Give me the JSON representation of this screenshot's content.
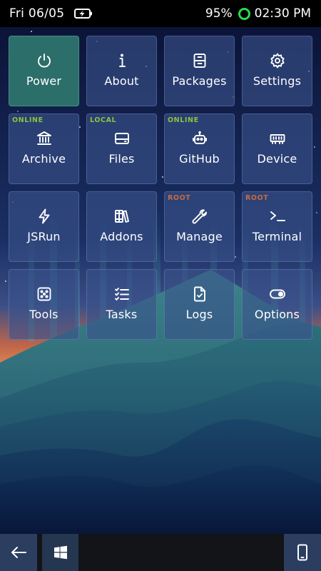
{
  "status_bar": {
    "date": "Fri 06/05",
    "battery_percent": "95%",
    "time": "02:30 PM",
    "charging_icon": "battery-charging-icon",
    "status_ring_color": "#2bd94b"
  },
  "tiles": [
    {
      "label": "Power",
      "icon": "power-icon",
      "tag": "",
      "active": true
    },
    {
      "label": "About",
      "icon": "info-icon",
      "tag": ""
    },
    {
      "label": "Packages",
      "icon": "package-icon",
      "tag": ""
    },
    {
      "label": "Settings",
      "icon": "gear-icon",
      "tag": ""
    },
    {
      "label": "Archive",
      "icon": "bank-icon",
      "tag": "ONLINE"
    },
    {
      "label": "Files",
      "icon": "hard-drive-icon",
      "tag": "LOCAL"
    },
    {
      "label": "GitHub",
      "icon": "robot-icon",
      "tag": "ONLINE"
    },
    {
      "label": "Device",
      "icon": "memory-chip-icon",
      "tag": ""
    },
    {
      "label": "JSRun",
      "icon": "lightning-icon",
      "tag": ""
    },
    {
      "label": "Addons",
      "icon": "books-icon",
      "tag": ""
    },
    {
      "label": "Manage",
      "icon": "wrench-icon",
      "tag": "ROOT"
    },
    {
      "label": "Terminal",
      "icon": "terminal-icon",
      "tag": "ROOT"
    },
    {
      "label": "Tools",
      "icon": "dice-icon",
      "tag": ""
    },
    {
      "label": "Tasks",
      "icon": "checklist-icon",
      "tag": ""
    },
    {
      "label": "Logs",
      "icon": "file-check-icon",
      "tag": ""
    },
    {
      "label": "Options",
      "icon": "toggle-icon",
      "tag": ""
    }
  ],
  "taskbar": {
    "back_icon": "arrow-left-icon",
    "start_icon": "windows-logo-icon",
    "device_icon": "phone-icon"
  },
  "colors": {
    "tile_active": "#2c6e69",
    "tag_green": "#8cc23f",
    "tag_root": "#c76a3f"
  }
}
